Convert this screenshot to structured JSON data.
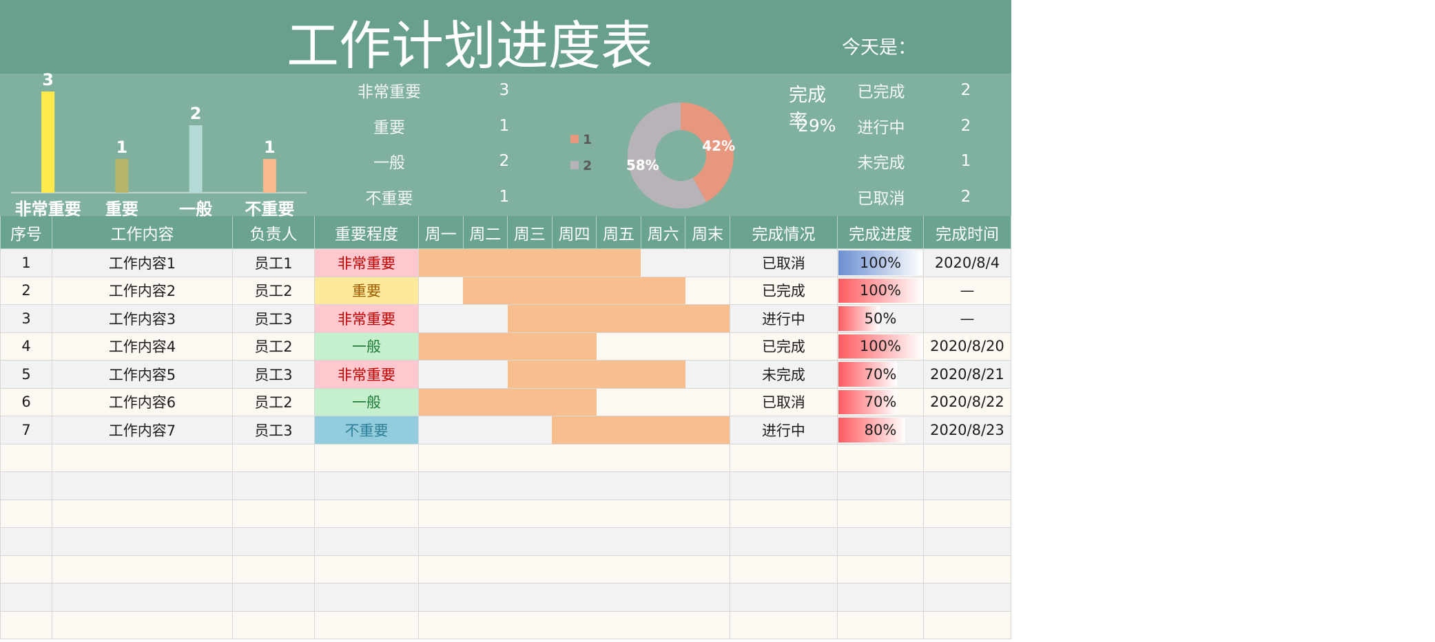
{
  "title": "工作计划进度表",
  "today_label": "今天是：",
  "importance_summary": [
    {
      "label": "非常重要",
      "count": "3"
    },
    {
      "label": "重要",
      "count": "1"
    },
    {
      "label": "一般",
      "count": "2"
    },
    {
      "label": "不重要",
      "count": "1"
    }
  ],
  "completion_rate": {
    "label": "完成率",
    "value": "29%"
  },
  "status_summary": [
    {
      "label": "已完成",
      "count": "2"
    },
    {
      "label": "进行中",
      "count": "2"
    },
    {
      "label": "未完成",
      "count": "1"
    },
    {
      "label": "已取消",
      "count": "2"
    }
  ],
  "colors": {
    "title_band": "#68a08d",
    "summary_band": "#80b09e",
    "header": "#6aa38f",
    "row_gray": "#f2f2f2",
    "row_cream": "#fdf8f1",
    "gantt": "#f9be8d"
  },
  "importance_styles": {
    "非常重要": {
      "bg": "#ffc7ce",
      "fg": "#c00000"
    },
    "重要": {
      "bg": "#fee89b",
      "fg": "#9c5b00"
    },
    "一般": {
      "bg": "#c6efce",
      "fg": "#207a37"
    },
    "不重要": {
      "bg": "#93cddd",
      "fg": "#2f7f99"
    }
  },
  "chart_data": [
    {
      "type": "bar",
      "categories": [
        "非常重要",
        "重要",
        "一般",
        "不重要"
      ],
      "values": [
        3,
        1,
        2,
        1
      ],
      "colors": [
        "#ffe94b",
        "#b7b56a",
        "#b4dad5",
        "#f8b98b"
      ],
      "grid": false,
      "legend": "none"
    },
    {
      "type": "pie",
      "donut": true,
      "labels": [
        "1",
        "2"
      ],
      "values": [
        42,
        58
      ],
      "value_labels": [
        "42%",
        "58%"
      ],
      "colors": [
        "#e8977f",
        "#b8b3b8"
      ],
      "legend": "left"
    }
  ],
  "table": {
    "headers": [
      "序号",
      "工作内容",
      "负责人",
      "重要程度",
      "周一",
      "周二",
      "周三",
      "周四",
      "周五",
      "周六",
      "周末",
      "完成情况",
      "完成进度",
      "完成时间"
    ],
    "rows": [
      {
        "no": "1",
        "task": "工作内容1",
        "owner": "员工1",
        "importance": "非常重要",
        "days": {
          "start": 1,
          "end": 5
        },
        "status": "已取消",
        "progress": "100%",
        "bar_color": "#6b8fd1",
        "done_date": "2020/8/4"
      },
      {
        "no": "2",
        "task": "工作内容2",
        "owner": "员工2",
        "importance": "重要",
        "days": {
          "start": 2,
          "end": 6
        },
        "status": "已完成",
        "progress": "100%",
        "bar_color": "#ff5b60",
        "done_date": "—"
      },
      {
        "no": "3",
        "task": "工作内容3",
        "owner": "员工3",
        "importance": "非常重要",
        "days": {
          "start": 3,
          "end": 7
        },
        "status": "进行中",
        "progress": "50%",
        "bar_color": "#ff5b60",
        "done_date": "—"
      },
      {
        "no": "4",
        "task": "工作内容4",
        "owner": "员工2",
        "importance": "一般",
        "days": {
          "start": 1,
          "end": 4
        },
        "status": "已完成",
        "progress": "100%",
        "bar_color": "#ff5b60",
        "done_date": "2020/8/20"
      },
      {
        "no": "5",
        "task": "工作内容5",
        "owner": "员工3",
        "importance": "非常重要",
        "days": {
          "start": 3,
          "end": 6
        },
        "status": "未完成",
        "progress": "70%",
        "bar_color": "#ff5b60",
        "done_date": "2020/8/21"
      },
      {
        "no": "6",
        "task": "工作内容6",
        "owner": "员工2",
        "importance": "一般",
        "days": {
          "start": 1,
          "end": 4
        },
        "status": "已取消",
        "progress": "70%",
        "bar_color": "#ff5b60",
        "done_date": "2020/8/22"
      },
      {
        "no": "7",
        "task": "工作内容7",
        "owner": "员工3",
        "importance": "不重要",
        "days": {
          "start": 4,
          "end": 7
        },
        "status": "进行中",
        "progress": "80%",
        "bar_color": "#ff5b60",
        "done_date": "2020/8/23"
      }
    ]
  }
}
